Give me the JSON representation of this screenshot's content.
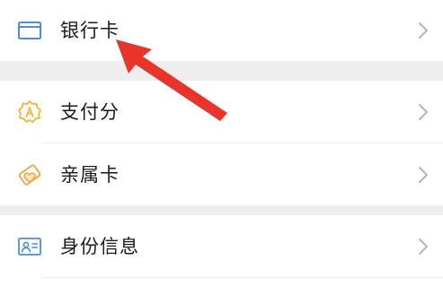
{
  "menu": {
    "items": [
      {
        "label": "银行卡",
        "icon": "bank-card-icon"
      },
      {
        "label": "支付分",
        "icon": "payment-score-icon"
      },
      {
        "label": "亲属卡",
        "icon": "family-card-icon"
      },
      {
        "label": "身份信息",
        "icon": "id-card-icon"
      }
    ]
  },
  "colors": {
    "bank_card_icon": "#4a8fd6",
    "payment_score_icon": "#f2b531",
    "family_card_icon": "#f2a23c",
    "id_card_icon": "#4a8fd6",
    "chevron": "#b5b5b5",
    "section_gap": "#eeeeee",
    "annotation_arrow": "#e8342b"
  }
}
